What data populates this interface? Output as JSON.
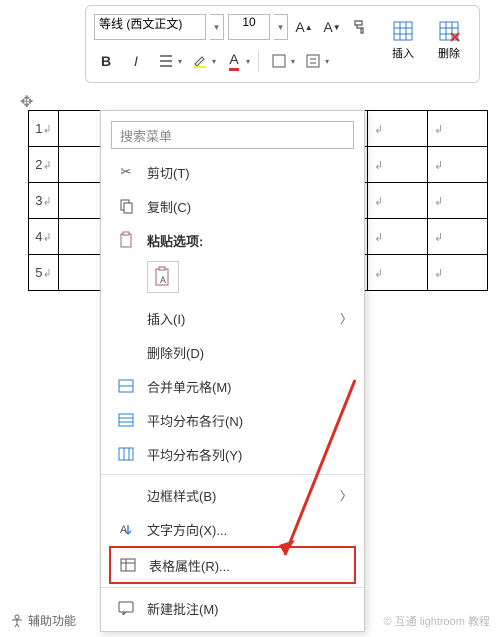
{
  "toolbar": {
    "font": "等线 (西文正文)",
    "size": "10",
    "insert_label": "插入",
    "delete_label": "删除"
  },
  "table": {
    "rows": [
      "1",
      "2",
      "3",
      "4",
      "5"
    ],
    "mark": "↲"
  },
  "context_menu": {
    "search_placeholder": "搜索菜单",
    "cut": "剪切(T)",
    "copy": "复制(C)",
    "paste_options": "粘贴选项:",
    "insert": "插入(I)",
    "delete_col": "删除列(D)",
    "merge_cells": "合并单元格(M)",
    "dist_rows": "平均分布各行(N)",
    "dist_cols": "平均分布各列(Y)",
    "border_style": "边框样式(B)",
    "text_dir": "文字方向(X)...",
    "table_props": "表格属性(R)...",
    "new_comment": "新建批注(M)"
  },
  "footer": {
    "accessibility": "辅助功能"
  },
  "watermark": "© 互通 lightroom 教程"
}
